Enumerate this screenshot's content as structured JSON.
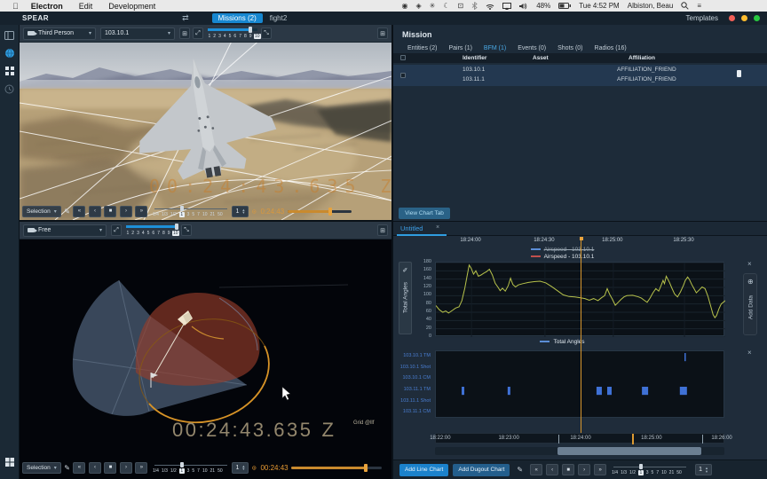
{
  "menubar": {
    "apple_logo": "",
    "menus": [
      "Electron",
      "Edit",
      "Development"
    ],
    "battery": "48%",
    "clock": "Tue 4:52 PM",
    "user": "Albiston, Beau"
  },
  "titlebar": {
    "app_name": "SPEAR",
    "switcher_icon": "⇄",
    "mission_tab": "Missions (2)",
    "flight_tab": "fight2",
    "templates": "Templates",
    "traffic_lights": [
      "#f35f57",
      "#febc2e",
      "#28c840"
    ]
  },
  "viewport_top": {
    "camera_mode": "Third Person",
    "entity": "103.10.1",
    "camera_slots": [
      "1",
      "2",
      "3",
      "4",
      "5",
      "6",
      "7",
      "8",
      "9",
      "10"
    ],
    "selected_slot": "10",
    "overlay_time": "00:24:43.635 Z"
  },
  "viewport_bottom": {
    "camera_mode": "Free",
    "camera_slots": [
      "1",
      "2",
      "3",
      "4",
      "5",
      "6",
      "7",
      "8",
      "9",
      "10"
    ],
    "selected_slot": "10",
    "clock_time": "00:24:43.635",
    "clock_zone": "Z",
    "grid_label": "Grid @llf"
  },
  "playback": {
    "selection": "Selection",
    "speeds": [
      "1/4",
      "1/3",
      "1/2",
      "1",
      "3",
      "5",
      "7",
      "10",
      "21",
      "50"
    ],
    "active_speed": "1",
    "step": "1",
    "top_time": "0:24:43",
    "bottom_time": "00:24:43"
  },
  "mission": {
    "title": "Mission",
    "tabs": [
      {
        "label": "Entities (2)",
        "active": false
      },
      {
        "label": "Pairs (1)",
        "active": false
      },
      {
        "label": "BFM (1)",
        "active": true
      },
      {
        "label": "Events (0)",
        "active": false
      },
      {
        "label": "Shots (0)",
        "active": false
      },
      {
        "label": "Radios (16)",
        "active": false
      }
    ],
    "columns": [
      "Identifier",
      "Asset",
      "Affiliation"
    ],
    "rows": [
      {
        "identifier": "103.10.1",
        "asset": "",
        "affiliation": "AFFILIATION_FRIEND"
      },
      {
        "identifier": "103.11.1",
        "asset": "",
        "affiliation": "AFFILIATION_FRIEND"
      }
    ],
    "view_chart_tab": "View Chart Tab"
  },
  "charts": {
    "tab": "Untitled",
    "add_line_chart": "Add Line Chart",
    "add_dugout_chart": "Add Dugout Chart",
    "add_data": "Add Data"
  },
  "chart_data": [
    {
      "type": "line",
      "ylabel": "Total Angles",
      "ylim": [
        0,
        180
      ],
      "y_ticks": [
        0,
        20,
        40,
        60,
        80,
        100,
        120,
        140,
        160,
        180
      ],
      "x_ticks": [
        {
          "label": "18:24:00",
          "frac": 0.123
        },
        {
          "label": "18:24:30",
          "frac": 0.377
        },
        {
          "label": "18:25:00",
          "frac": 0.613
        },
        {
          "label": "18:25:30",
          "frac": 0.859
        }
      ],
      "legend_top": [
        {
          "name": "Airspeed - 103.10.1",
          "color": "#5b8dd6",
          "hidden": true
        },
        {
          "name": "Airspeed - 103.10.1",
          "color": "#c0504d",
          "hidden": false
        }
      ],
      "legend_bottom": [
        {
          "name": "Total Angles",
          "color": "#5b8dd6"
        }
      ],
      "line_color": "#b7c24b",
      "cursor_frac": 0.506,
      "points": [
        [
          0,
          76
        ],
        [
          0.012,
          66
        ],
        [
          0.024,
          60
        ],
        [
          0.034,
          63
        ],
        [
          0.044,
          58
        ],
        [
          0.056,
          64
        ],
        [
          0.068,
          70
        ],
        [
          0.08,
          73
        ],
        [
          0.09,
          88
        ],
        [
          0.1,
          118
        ],
        [
          0.108,
          148
        ],
        [
          0.115,
          174
        ],
        [
          0.122,
          166
        ],
        [
          0.13,
          152
        ],
        [
          0.138,
          160
        ],
        [
          0.147,
          147
        ],
        [
          0.156,
          150
        ],
        [
          0.165,
          154
        ],
        [
          0.175,
          158
        ],
        [
          0.185,
          164
        ],
        [
          0.195,
          150
        ],
        [
          0.205,
          130
        ],
        [
          0.215,
          120
        ],
        [
          0.222,
          112
        ],
        [
          0.23,
          118
        ],
        [
          0.24,
          111
        ],
        [
          0.25,
          124
        ],
        [
          0.258,
          142
        ],
        [
          0.266,
          127
        ],
        [
          0.275,
          121
        ],
        [
          0.285,
          126
        ],
        [
          0.3,
          129
        ],
        [
          0.32,
          132
        ],
        [
          0.34,
          134
        ],
        [
          0.36,
          135
        ],
        [
          0.38,
          131
        ],
        [
          0.4,
          122
        ],
        [
          0.42,
          112
        ],
        [
          0.44,
          102
        ],
        [
          0.46,
          98
        ],
        [
          0.48,
          97
        ],
        [
          0.5,
          95
        ],
        [
          0.515,
          93
        ],
        [
          0.53,
          89
        ],
        [
          0.545,
          93
        ],
        [
          0.56,
          88
        ],
        [
          0.572,
          95
        ],
        [
          0.583,
          100
        ],
        [
          0.592,
          117
        ],
        [
          0.6,
          104
        ],
        [
          0.61,
          91
        ],
        [
          0.62,
          77
        ],
        [
          0.63,
          84
        ],
        [
          0.64,
          91
        ],
        [
          0.65,
          97
        ],
        [
          0.66,
          100
        ],
        [
          0.68,
          101
        ],
        [
          0.7,
          97
        ],
        [
          0.71,
          94
        ],
        [
          0.72,
          89
        ],
        [
          0.73,
          84
        ],
        [
          0.74,
          94
        ],
        [
          0.75,
          107
        ],
        [
          0.76,
          117
        ],
        [
          0.77,
          111
        ],
        [
          0.778,
          124
        ],
        [
          0.785,
          137
        ],
        [
          0.79,
          129
        ],
        [
          0.796,
          147
        ],
        [
          0.802,
          139
        ],
        [
          0.808,
          131
        ],
        [
          0.815,
          119
        ],
        [
          0.825,
          104
        ],
        [
          0.835,
          97
        ],
        [
          0.845,
          109
        ],
        [
          0.855,
          124
        ],
        [
          0.862,
          137
        ],
        [
          0.87,
          145
        ],
        [
          0.876,
          139
        ],
        [
          0.884,
          127
        ],
        [
          0.892,
          117
        ],
        [
          0.9,
          107
        ],
        [
          0.91,
          114
        ],
        [
          0.92,
          121
        ],
        [
          0.93,
          117
        ],
        [
          0.94,
          99
        ],
        [
          0.95,
          74
        ],
        [
          0.958,
          54
        ],
        [
          0.964,
          47
        ],
        [
          0.97,
          52
        ],
        [
          0.978,
          68
        ],
        [
          0.986,
          80
        ],
        [
          1,
          88
        ]
      ]
    },
    {
      "type": "gantt",
      "rows": [
        "103.10.1 TM",
        "103.10.1 Shot",
        "103.10.1 CM",
        "103.11.1 TM",
        "103.11.1 Shot",
        "103.11.1 CM"
      ],
      "bar_color": "#3f71d6",
      "bars": [
        {
          "row": 3,
          "frac": 0.089,
          "w": 3
        },
        {
          "row": 3,
          "frac": 0.248,
          "w": 3
        },
        {
          "row": 3,
          "frac": 0.555,
          "w": 6
        },
        {
          "row": 3,
          "frac": 0.592,
          "w": 5
        },
        {
          "row": 3,
          "frac": 0.712,
          "w": 7
        },
        {
          "row": 3,
          "frac": 0.843,
          "w": 8
        },
        {
          "row": 0,
          "frac": 0.859,
          "w": 1.5
        }
      ]
    },
    {
      "type": "overview-axis",
      "labels": [
        {
          "label": "18:22:00",
          "frac": 0.015
        },
        {
          "label": "18:23:00",
          "frac": 0.252
        },
        {
          "label": "18:24:00",
          "frac": 0.5
        },
        {
          "label": "18:25:00",
          "frac": 0.745
        },
        {
          "label": "18:26:00",
          "frac": 0.988
        }
      ],
      "cursor_frac": 0.678,
      "brush": [
        0.423,
        0.92
      ]
    }
  ]
}
